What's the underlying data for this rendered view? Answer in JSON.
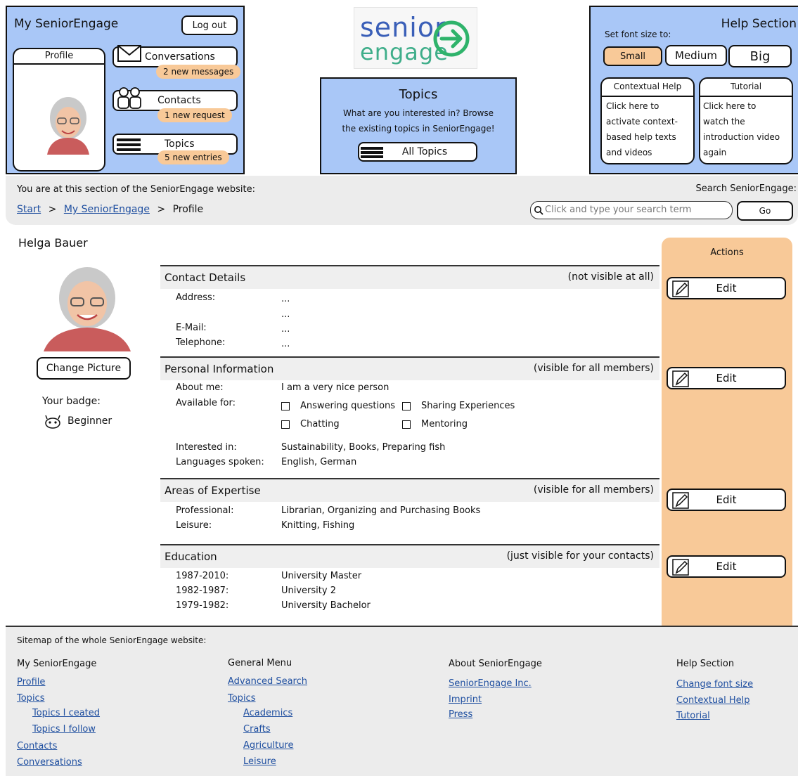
{
  "my_panel": {
    "title": "My SeniorEngage",
    "logout": "Log out",
    "profile_label": "Profile",
    "conversations": {
      "label": "Conversations",
      "badge": "2 new messages"
    },
    "contacts": {
      "label": "Contacts",
      "badge": "1 new request"
    },
    "topics": {
      "label": "Topics",
      "badge": "5 new entries"
    }
  },
  "logo": {
    "line1": "senior",
    "line2": "engage"
  },
  "topics_panel": {
    "title": "Topics",
    "text1": "What are you interested in? Browse",
    "text2": "the existing topics in SeniorEngage!",
    "button": "All Topics"
  },
  "help_panel": {
    "title": "Help Section",
    "font_label": "Set font size to:",
    "small": "Small",
    "medium": "Medium",
    "big": "Big",
    "contextual": {
      "title": "Contextual Help",
      "lines": [
        "Click here to",
        "activate context-",
        "based help texts",
        "and videos"
      ]
    },
    "tutorial": {
      "title": "Tutorial",
      "lines": [
        "Click here to",
        "watch the",
        "introduction video",
        "again"
      ]
    }
  },
  "nav": {
    "location_text": "You are at this section of the SeniorEngage website:",
    "crumb_start": "Start",
    "crumb_sep": ">",
    "crumb_my": "My SeniorEngage",
    "crumb_current": "Profile",
    "search_label": "Search SeniorEngage:",
    "search_placeholder": "Click and type your search term",
    "go": "Go"
  },
  "profile": {
    "name": "Helga Bauer",
    "change_picture": "Change Picture",
    "badge_label": "Your badge:",
    "badge_value": "Beginner"
  },
  "actions": {
    "title": "Actions",
    "edit": "Edit"
  },
  "contact_details": {
    "title": "Contact Details",
    "visibility": "(not visible at all)",
    "address_label": "Address:",
    "address_value": "...",
    "address_value2": "...",
    "email_label": "E-Mail:",
    "email_value": "...",
    "phone_label": "Telephone:",
    "phone_value": "..."
  },
  "personal": {
    "title": "Personal Information",
    "visibility": "(visible for all members)",
    "about_label": "About me:",
    "about_value": "I am a very nice person",
    "available_label": "Available for:",
    "opt1": "Answering questions",
    "opt2": "Sharing Experiences",
    "opt3": "Chatting",
    "opt4": "Mentoring",
    "interested_label": "Interested in:",
    "interested_value": "Sustainability, Books, Preparing fish",
    "languages_label": "Languages spoken:",
    "languages_value": "English, German"
  },
  "expertise": {
    "title": "Areas of Expertise",
    "visibility": "(visible for all members)",
    "professional_label": "Professional:",
    "professional_value": "Librarian, Organizing and Purchasing Books",
    "leisure_label": "Leisure:",
    "leisure_value": "Knitting, Fishing"
  },
  "education": {
    "title": "Education",
    "visibility": "(just visible for your contacts)",
    "rows": [
      {
        "years": "1987-2010:",
        "value": "University Master"
      },
      {
        "years": "1982-1987:",
        "value": "University 2"
      },
      {
        "years": "1979-1982:",
        "value": "University Bachelor"
      }
    ]
  },
  "sitemap": {
    "title": "Sitemap of the whole SeniorEngage website:",
    "col1": {
      "head": "My SeniorEngage",
      "links": [
        "Profile",
        "Topics",
        "Topics I ceated",
        "Topics I follow",
        "Contacts",
        "Conversations"
      ]
    },
    "col2": {
      "head": "General Menu",
      "links": [
        "Advanced Search",
        "Topics",
        "Academics",
        "Crafts",
        "Agriculture",
        "Leisure"
      ]
    },
    "col3": {
      "head": "About SeniorEngage",
      "links": [
        "SeniorEngage Inc.",
        "Imprint",
        "Press"
      ]
    },
    "col4": {
      "head": "Help Section",
      "links": [
        "Change font size",
        "Contextual Help",
        "Tutorial"
      ]
    }
  },
  "colors": {
    "panel_blue": "#a9c7f7",
    "accent_orange": "#f8c998",
    "link_blue": "#1f4fa0",
    "logo_blue": "#3a5fb8",
    "logo_green": "#2fb36b"
  }
}
